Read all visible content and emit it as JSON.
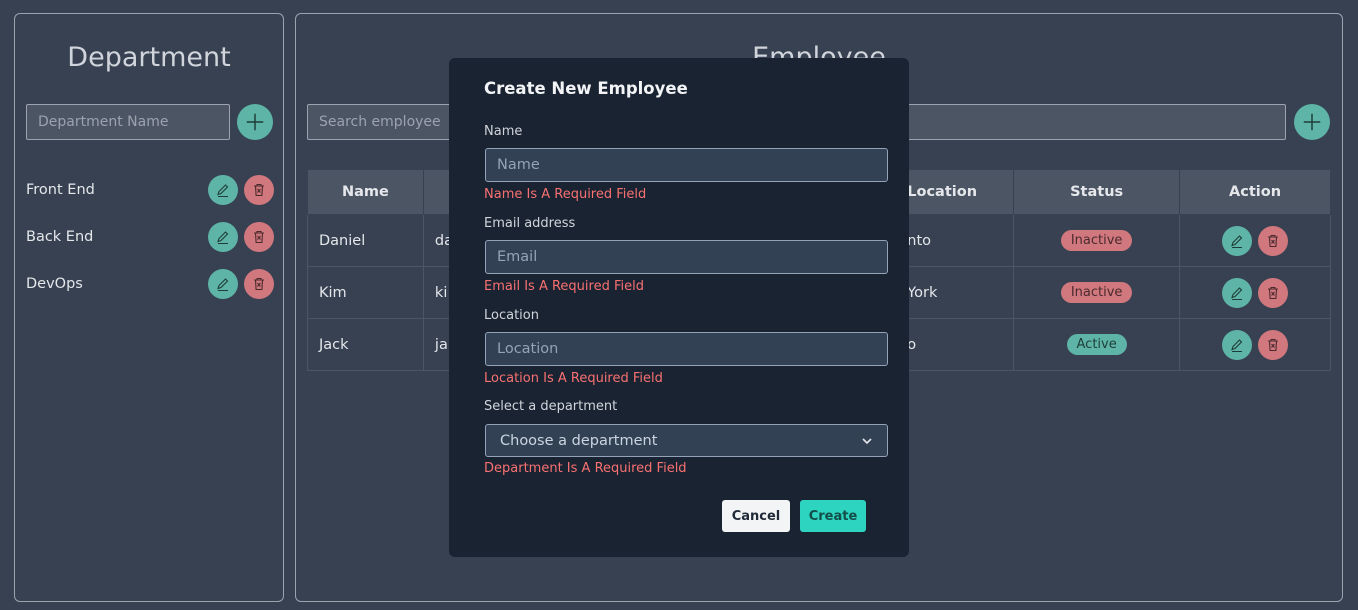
{
  "department": {
    "title": "Department",
    "input_placeholder": "Department Name",
    "items": [
      {
        "label": "Front End"
      },
      {
        "label": "Back End"
      },
      {
        "label": "DevOps"
      }
    ]
  },
  "employee": {
    "title": "Employee",
    "search_placeholder": "Search employee",
    "columns": [
      "Name",
      "",
      "Location",
      "Status",
      "Action"
    ],
    "rows": [
      {
        "name": "Daniel",
        "email": "da",
        "location": "nto",
        "status": "Inactive"
      },
      {
        "name": "Kim",
        "email": "ki",
        "location": "York",
        "status": "Inactive"
      },
      {
        "name": "Jack",
        "email": "ja",
        "location": "o",
        "status": "Active"
      }
    ]
  },
  "modal": {
    "title": "Create New Employee",
    "name_label": "Name",
    "name_placeholder": "Name",
    "name_error": "Name Is A Required Field",
    "email_label": "Email address",
    "email_placeholder": "Email",
    "email_error": "Email Is A Required Field",
    "location_label": "Location",
    "location_placeholder": "Location",
    "location_error": "Location Is A Required Field",
    "department_label": "Select a department",
    "department_selected": "Choose a department",
    "department_error": "Department Is A Required Field",
    "cancel_label": "Cancel",
    "create_label": "Create"
  },
  "colors": {
    "accent_teal": "#5eb4a7",
    "danger_red": "#d0787d",
    "error_text": "#f87171",
    "create_button": "#2dd4bf"
  }
}
